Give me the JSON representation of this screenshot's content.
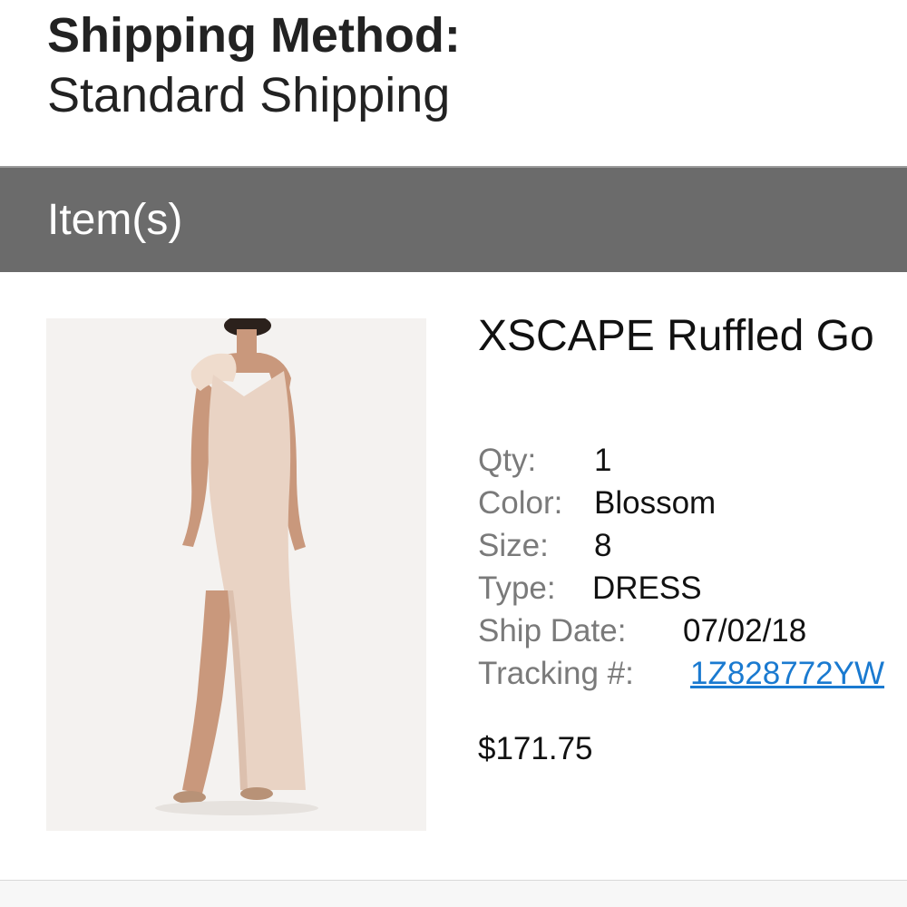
{
  "shipping": {
    "heading": "Shipping Method:",
    "value": "Standard Shipping"
  },
  "items_section": {
    "label": "Item(s)"
  },
  "product": {
    "image_alt": "XSCAPE Ruffled Gown in Blossom",
    "title": "XSCAPE Ruffled Go",
    "details": [
      {
        "label": "Qty:",
        "value": "1"
      },
      {
        "label": "Color:",
        "value": "Blossom"
      },
      {
        "label": "Size:",
        "value": "8"
      },
      {
        "label": "Type:",
        "value": "DRESS"
      },
      {
        "label": "Ship Date:",
        "value": "07/02/18"
      },
      {
        "label": "Tracking #:",
        "value": "1Z828772YW"
      }
    ],
    "price": "$171.75"
  },
  "colors": {
    "section_bar": "#6b6b6b",
    "link": "#1a7ad0",
    "label_gray": "#7a7a7a",
    "dress_blush": "#e9d3c4"
  }
}
